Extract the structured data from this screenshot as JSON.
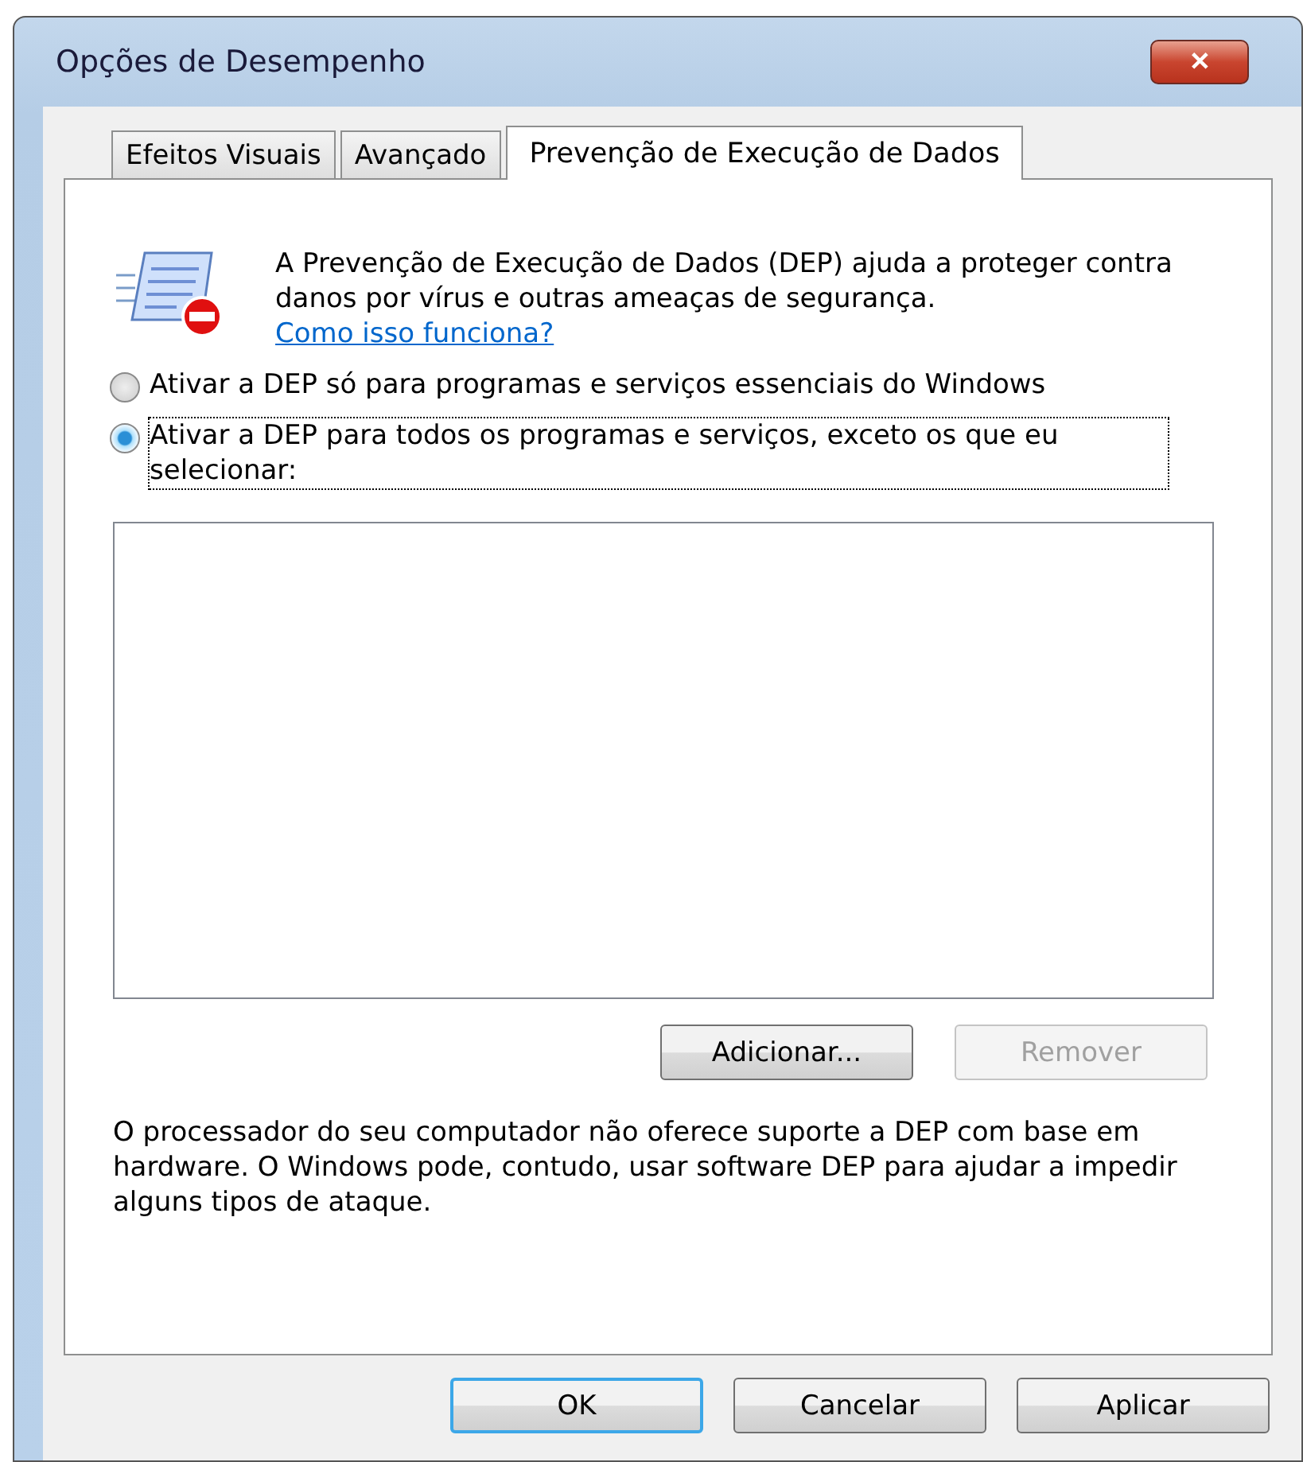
{
  "window": {
    "title": "Opções de Desempenho",
    "close": "✕"
  },
  "tabs": [
    {
      "label": "Efeitos Visuais",
      "selected": false
    },
    {
      "label": "Avançado",
      "selected": false
    },
    {
      "label": "Prevenção de Execução de Dados",
      "selected": true
    }
  ],
  "intro": {
    "text": "A Prevenção de Execução de Dados (DEP) ajuda a proteger contra danos por vírus e outras ameaças de segurança.",
    "link": "Como isso funciona?"
  },
  "options": [
    {
      "label": "Ativar a DEP só para programas e serviços essenciais do Windows",
      "selected": false
    },
    {
      "label": "Ativar a DEP para todos os programas e serviços, exceto os que eu selecionar:",
      "selected": true
    }
  ],
  "list_buttons": [
    {
      "label": "Adicionar...",
      "disabled": false
    },
    {
      "label": "Remover",
      "disabled": true
    }
  ],
  "note": "O processador do seu computador não oferece suporte a DEP com base em hardware. O Windows pode, contudo, usar software DEP para ajudar a impedir alguns tipos de ataque.",
  "buttons": [
    {
      "label": "OK",
      "default": true
    },
    {
      "label": "Cancelar",
      "default": false
    },
    {
      "label": "Aplicar",
      "default": false
    }
  ]
}
